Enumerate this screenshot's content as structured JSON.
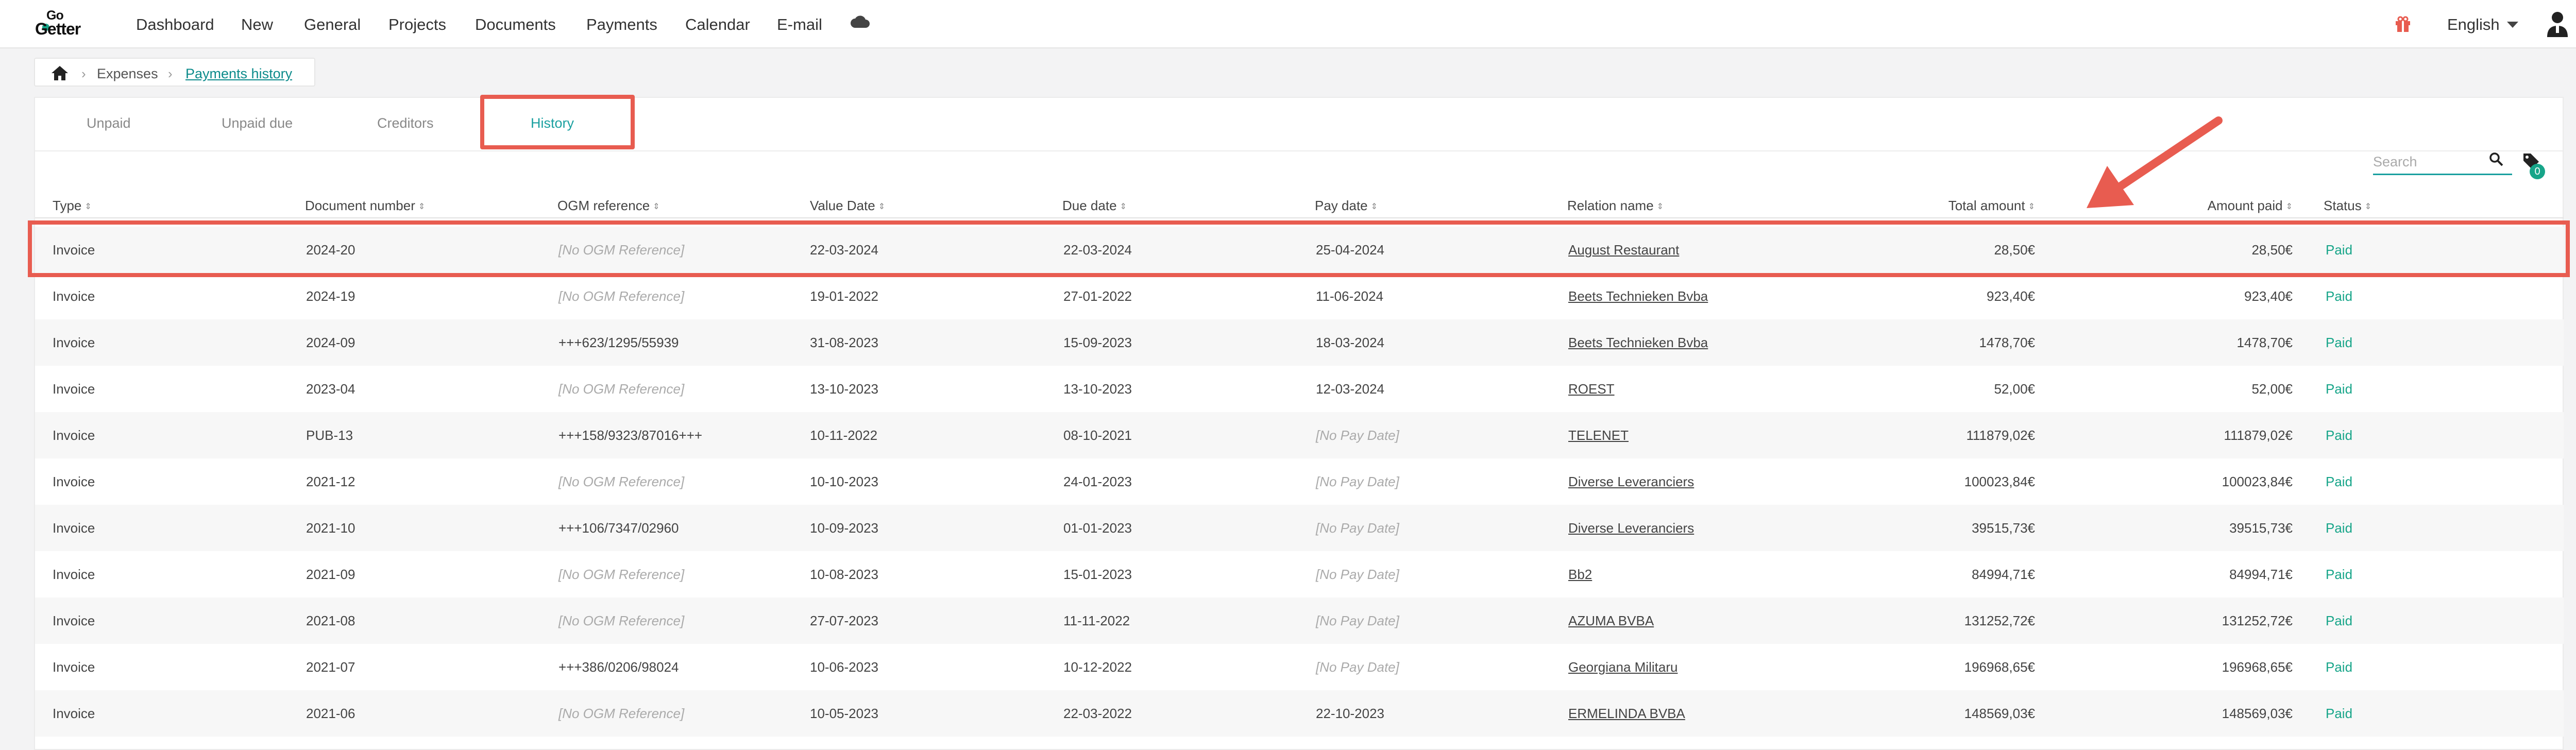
{
  "nav": {
    "logo_top": "Go",
    "logo_bottom": "Getter",
    "items": [
      "Dashboard",
      "New",
      "General",
      "Projects",
      "Documents",
      "Payments",
      "Calendar",
      "E-mail"
    ],
    "language": "English"
  },
  "breadcrumb": {
    "items": [
      "Expenses",
      "Payments history"
    ]
  },
  "tabs": [
    "Unpaid",
    "Unpaid due",
    "Creditors",
    "History"
  ],
  "active_tab": "History",
  "search": {
    "placeholder": "Search",
    "value": ""
  },
  "tags_count": "0",
  "table": {
    "headers": [
      "Type",
      "Document number",
      "OGM reference",
      "Value Date",
      "Due date",
      "Pay date",
      "Relation name",
      "Total amount",
      "Amount paid",
      "Status"
    ],
    "rows": [
      [
        "Invoice",
        "2024-20",
        "[No OGM Reference]",
        "22-03-2024",
        "22-03-2024",
        "25-04-2024",
        "August Restaurant",
        "28,50€",
        "28,50€",
        "Paid"
      ],
      [
        "Invoice",
        "2024-19",
        "[No OGM Reference]",
        "19-01-2022",
        "27-01-2022",
        "11-06-2024",
        "Beets Technieken Bvba",
        "923,40€",
        "923,40€",
        "Paid"
      ],
      [
        "Invoice",
        "2024-09",
        "+++623/1295/55939",
        "31-08-2023",
        "15-09-2023",
        "18-03-2024",
        "Beets Technieken Bvba",
        "1478,70€",
        "1478,70€",
        "Paid"
      ],
      [
        "Invoice",
        "2023-04",
        "[No OGM Reference]",
        "13-10-2023",
        "13-10-2023",
        "12-03-2024",
        "ROEST",
        "52,00€",
        "52,00€",
        "Paid"
      ],
      [
        "Invoice",
        "PUB-13",
        "+++158/9323/87016+++",
        "10-11-2022",
        "08-10-2021",
        "[No Pay Date]",
        "TELENET",
        "111879,02€",
        "111879,02€",
        "Paid"
      ],
      [
        "Invoice",
        "2021-12",
        "[No OGM Reference]",
        "10-10-2023",
        "24-01-2023",
        "[No Pay Date]",
        "Diverse Leveranciers",
        "100023,84€",
        "100023,84€",
        "Paid"
      ],
      [
        "Invoice",
        "2021-10",
        "+++106/7347/02960",
        "10-09-2023",
        "01-01-2023",
        "[No Pay Date]",
        "Diverse Leveranciers",
        "39515,73€",
        "39515,73€",
        "Paid"
      ],
      [
        "Invoice",
        "2021-09",
        "[No OGM Reference]",
        "10-08-2023",
        "15-01-2023",
        "[No Pay Date]",
        "Bb2",
        "84994,71€",
        "84994,71€",
        "Paid"
      ],
      [
        "Invoice",
        "2021-08",
        "[No OGM Reference]",
        "27-07-2023",
        "11-11-2022",
        "[No Pay Date]",
        "AZUMA BVBA",
        "131252,72€",
        "131252,72€",
        "Paid"
      ],
      [
        "Invoice",
        "2021-07",
        "+++386/0206/98024",
        "10-06-2023",
        "10-12-2022",
        "[No Pay Date]",
        "Georgiana Militaru",
        "196968,65€",
        "196968,65€",
        "Paid"
      ],
      [
        "Invoice",
        "2021-06",
        "[No OGM Reference]",
        "10-05-2023",
        "22-03-2022",
        "22-10-2023",
        "ERMELINDA BVBA",
        "148569,03€",
        "148569,03€",
        "Paid"
      ]
    ]
  },
  "colors": {
    "accent": "#1aa0a0",
    "paid": "#17a589",
    "highlight": "#e85c50"
  }
}
